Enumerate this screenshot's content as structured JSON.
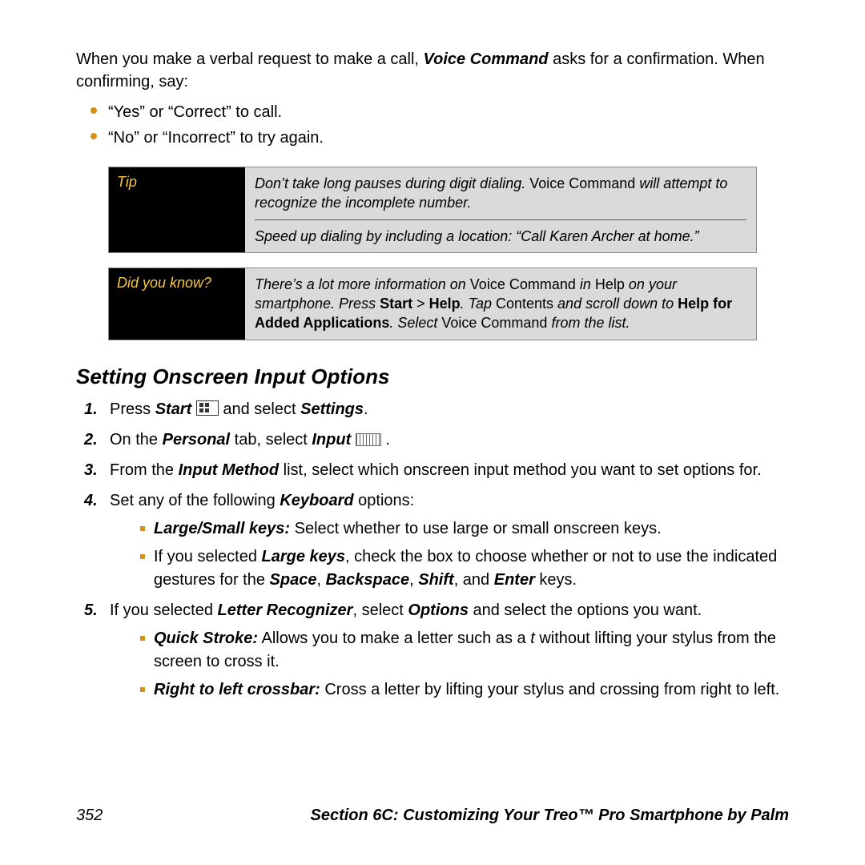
{
  "intro": {
    "line1_a": "When you make a verbal request to make a call, ",
    "line1_b": "Voice Command",
    "line1_c": " asks for a confirmation. When confirming, say:"
  },
  "confirm_list": {
    "item1": "“Yes” or “Correct” to call.",
    "item2": "“No” or “Incorrect” to try again."
  },
  "tip_box": {
    "label": "Tip",
    "row1_a": "Don’t take long pauses during digit dialing. ",
    "row1_b": "Voice Command",
    "row1_c": " will attempt to recognize the incomplete number.",
    "row2": "Speed up dialing by including a location: “Call Karen Archer at home.”"
  },
  "dyk_box": {
    "label": "Did you know?",
    "a": "There’s a lot more information on ",
    "b": "Voice Command",
    "c": " in ",
    "d": "Help",
    "e": " on your smartphone. Press ",
    "f": "Start",
    "g": " > ",
    "h": "Help",
    "i": ". Tap ",
    "j": "Contents",
    "k": " and scroll down to ",
    "l": "Help for Added Applications",
    "m": ". Select ",
    "n": "Voice Command",
    "o": " from the list."
  },
  "section_heading": "Setting Onscreen Input Options",
  "steps": {
    "s1_a": "Press ",
    "s1_b": "Start",
    "s1_c": " and select ",
    "s1_d": "Settings",
    "s1_e": ".",
    "s2_a": "On the ",
    "s2_b": "Personal",
    "s2_c": " tab, select ",
    "s2_d": "Input",
    "s2_e": " .",
    "s3_a": "From the ",
    "s3_b": "Input Method",
    "s3_c": " list, select which onscreen input method you want to set options for.",
    "s4_a": "Set any of the following ",
    "s4_b": "Keyboard",
    "s4_c": " options:",
    "s4_sub1_a": "Large/Small keys:",
    "s4_sub1_b": " Select whether to use large or small onscreen keys.",
    "s4_sub2_a": "If you selected ",
    "s4_sub2_b": "Large keys",
    "s4_sub2_c": ", check the box to choose whether or not to use the indicated gestures for the ",
    "s4_sub2_d": "Space",
    "s4_sub2_e": ", ",
    "s4_sub2_f": "Backspace",
    "s4_sub2_g": ", ",
    "s4_sub2_h": "Shift",
    "s4_sub2_i": ", and ",
    "s4_sub2_j": "Enter",
    "s4_sub2_k": " keys.",
    "s5_a": "If you selected ",
    "s5_b": "Letter Recognizer",
    "s5_c": ", select ",
    "s5_d": "Options",
    "s5_e": " and select the options you want.",
    "s5_sub1_a": "Quick Stroke:",
    "s5_sub1_b": " Allows you to make a letter such as a ",
    "s5_sub1_c": "t",
    "s5_sub1_d": " without lifting your stylus from the screen to cross it.",
    "s5_sub2_a": "Right to left crossbar:",
    "s5_sub2_b": " Cross a letter by lifting your stylus and crossing from right to left."
  },
  "footer": {
    "page": "352",
    "section": "Section 6C: Customizing Your Treo™ Pro Smartphone by Palm"
  }
}
